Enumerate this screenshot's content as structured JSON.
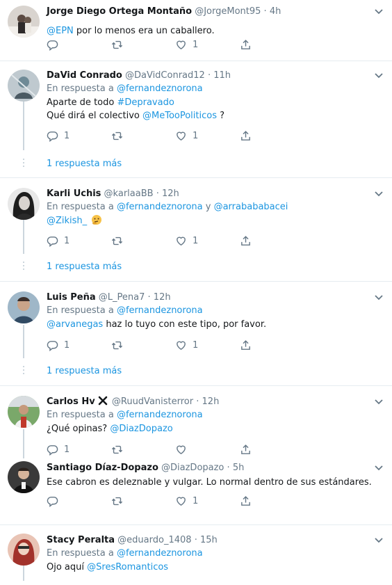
{
  "tweets": [
    {
      "name": "Jorge Diego Ortega Montaño",
      "handle": "@JorgeMont95",
      "time": "4h",
      "text_mention": "@EPN",
      "text_rest": " por lo menos era un caballero.",
      "likes": "1"
    },
    {
      "name": "DaVid Conrado",
      "handle": "@DaVidConrad12",
      "time": "11h",
      "reply_prefix": "En respuesta a ",
      "reply_to": "@fernandeznorona",
      "line1_text": "Aparte de todo ",
      "line1_hashtag": "#Depravado",
      "line2_text": "Qué dirá el colectivo ",
      "line2_mention": "@MeTooPoliticos",
      "line2_end": " ?",
      "replies": "1",
      "likes": "1",
      "more": "1 respuesta más"
    },
    {
      "name": "Karli Uchis",
      "handle": "@karlaaBB",
      "time": "12h",
      "reply_prefix": "En respuesta a ",
      "reply_to": "@fernandeznorona",
      "reply_and": " y ",
      "reply_to2": "@arrabababacei",
      "text_mention": "@Zikish_",
      "emoji": "thinking-face",
      "replies": "1",
      "likes": "1",
      "more": "1 respuesta más"
    },
    {
      "name": "Luis Peña",
      "handle": "@L_Pena7",
      "time": "12h",
      "reply_prefix": "En respuesta a ",
      "reply_to": "@fernandeznorona",
      "text_mention": "@arvanegas",
      "text_rest": " haz lo tuyo con este tipo, por favor.",
      "replies": "1",
      "likes": "1",
      "more": "1 respuesta más"
    },
    {
      "name": "Carlos Hv",
      "handle": "@RuudVanisterror",
      "time": "12h",
      "reply_prefix": "En respuesta a ",
      "reply_to": "@fernandeznorona",
      "text_start": "¿Qué opinas? ",
      "text_mention": "@DiazDopazo",
      "replies": "1"
    },
    {
      "name": "Santiago Díaz-Dopazo",
      "handle": "@DiazDopazo",
      "time": "5h",
      "text": "Ese cabron es deleznable y vulgar. Lo normal dentro de sus estándares.",
      "likes": "1"
    },
    {
      "name": "Stacy Peralta",
      "handle": "@eduardo_1408",
      "time": "15h",
      "reply_prefix": "En respuesta a ",
      "reply_to": "@fernandeznorona",
      "text_start": "Ojo aquí ",
      "text_mention": "@SresRomanticos"
    }
  ],
  "separator": "·",
  "colors": {
    "link": "#1b95e0",
    "muted": "#657786",
    "thread_line": "#ccd6dd",
    "divider": "#e6ecf0"
  },
  "icons": [
    "reply-icon",
    "retweet-icon",
    "like-icon",
    "share-icon",
    "chevron-down-icon",
    "x-badge-icon"
  ]
}
